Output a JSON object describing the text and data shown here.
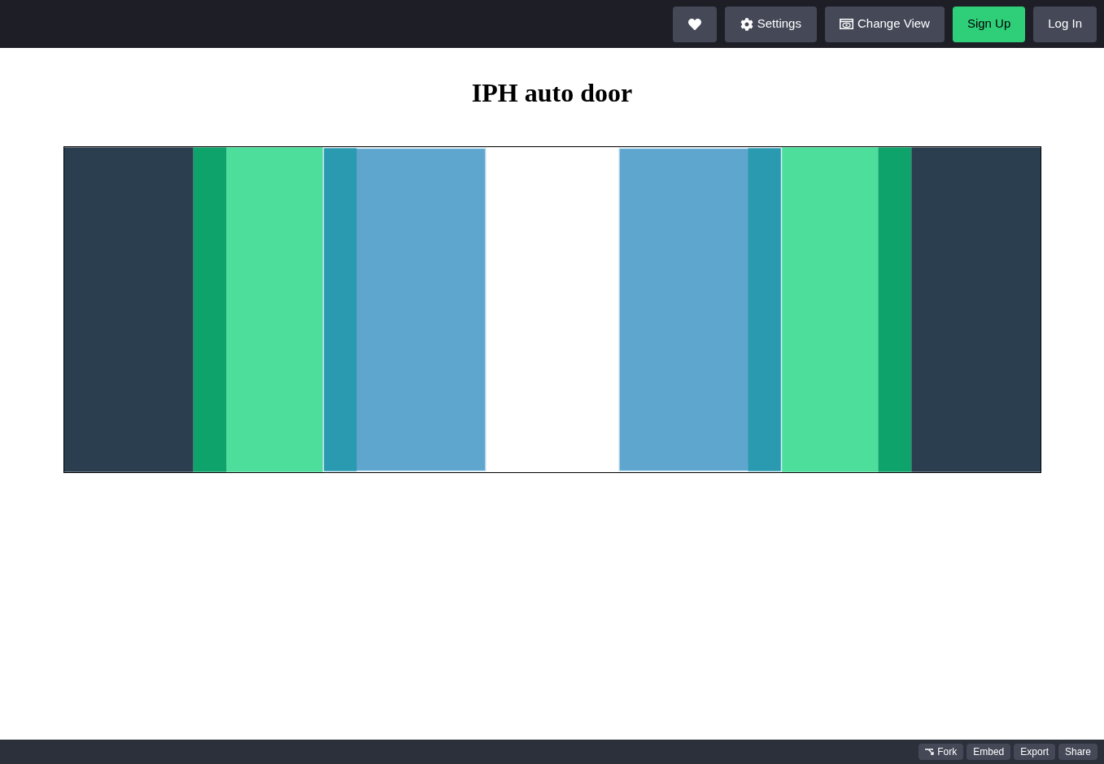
{
  "header": {
    "buttons": [
      {
        "kind": "like"
      },
      {
        "kind": "settings",
        "label": "Settings"
      },
      {
        "kind": "view",
        "label": "Change View"
      },
      {
        "kind": "signup",
        "label": "Sign Up"
      },
      {
        "kind": "login",
        "label": "Log In"
      }
    ]
  },
  "title": "IPH auto door",
  "footer": {
    "buttons": [
      {
        "kind": "fork",
        "label": "Fork"
      },
      {
        "kind": "plain",
        "label": "Embed"
      },
      {
        "kind": "plain",
        "label": "Export"
      },
      {
        "kind": "plain",
        "label": "Share"
      }
    ]
  }
}
